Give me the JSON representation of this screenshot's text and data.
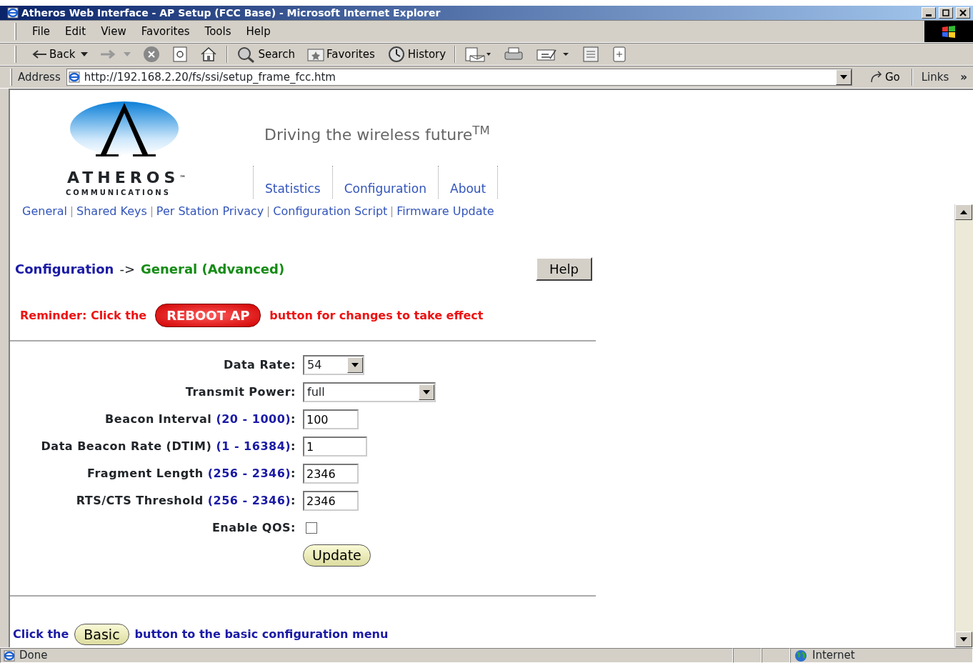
{
  "window": {
    "title": "Atheros Web Interface - AP Setup (FCC Base) - Microsoft Internet Explorer"
  },
  "menu": [
    "File",
    "Edit",
    "View",
    "Favorites",
    "Tools",
    "Help"
  ],
  "toolbar": [
    {
      "kind": "labeled",
      "label": "Back"
    },
    {
      "kind": "icon"
    },
    {
      "kind": "icon"
    },
    {
      "kind": "icon"
    },
    {
      "kind": "icon"
    },
    {
      "kind": "labeled",
      "label": "Search"
    },
    {
      "kind": "labeled",
      "label": "Favorites"
    },
    {
      "kind": "labeled",
      "label": "History"
    },
    {
      "kind": "icon"
    },
    {
      "kind": "icon"
    },
    {
      "kind": "icon"
    },
    {
      "kind": "icon"
    },
    {
      "kind": "icon"
    }
  ],
  "address_bar": {
    "label": "Address",
    "url": "http://192.168.2.20/fs/ssi/setup_frame_fcc.htm",
    "go": "Go",
    "links": "Links",
    "more": "»"
  },
  "header": {
    "brand": "ATHEROS",
    "brand_mark": "™",
    "brand_sub": "COMMUNICATIONS",
    "tagline": "Driving the wireless future$^{TM}$"
  },
  "tabs": [
    {
      "label": "Statistics"
    },
    {
      "label": "Configuration"
    },
    {
      "label": "About"
    }
  ],
  "sub_links": [
    "General",
    "Shared Keys",
    "Per Station Privacy",
    "Configuration Script",
    "Firmware Update"
  ],
  "breadcrumb": {
    "section": "Configuration",
    "arrow": "->",
    "page": "General (Advanced)"
  },
  "help_button": "Help",
  "reminder": {
    "before": "Reminder: Click the",
    "button": "REBOOT AP",
    "after": "button for changes to take effect"
  },
  "fields": [
    {
      "kind": "select",
      "label": "Data Rate:",
      "value": "54"
    },
    {
      "kind": "select",
      "label": "Transmit Power:",
      "value": "full"
    },
    {
      "kind": "text",
      "label": "Beacon Interval",
      "range": "(20 - 1000)",
      "suffix": ":",
      "value": "100"
    },
    {
      "kind": "text",
      "label": "Data Beacon Rate (DTIM)",
      "range": "(1 - 16384)",
      "suffix": ":",
      "value": "1"
    },
    {
      "kind": "text",
      "label": "Fragment Length",
      "range": "(256 - 2346)",
      "suffix": ":",
      "value": "2346"
    },
    {
      "kind": "text",
      "label": "RTS/CTS Threshold",
      "range": "(256 - 2346)",
      "suffix": ":",
      "value": "2346"
    },
    {
      "kind": "checkbox",
      "label": "Enable QOS:",
      "checked": false
    }
  ],
  "update_button": "Update",
  "footer": {
    "before": "Click the",
    "button": "Basic",
    "after": "button to the basic configuration menu"
  },
  "status_bar": {
    "text": "Done",
    "zone": "Internet"
  }
}
